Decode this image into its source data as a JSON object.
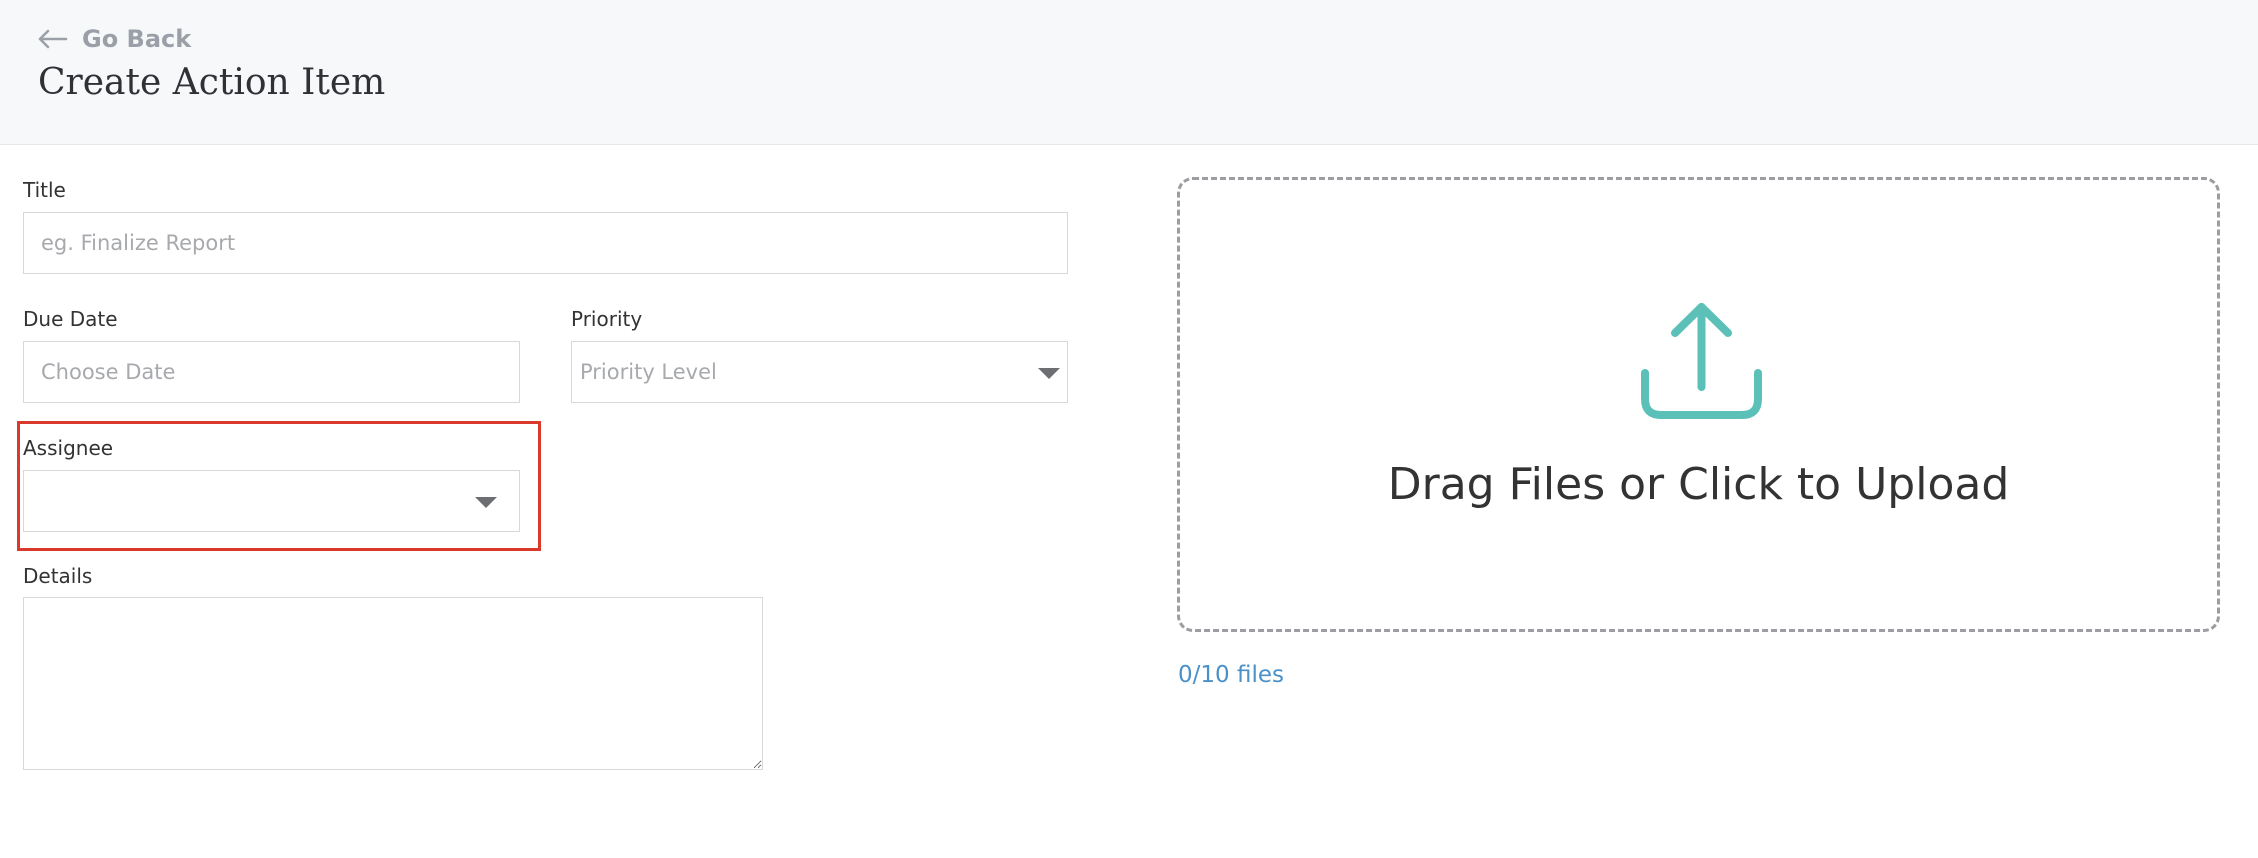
{
  "header": {
    "back_label": "Go Back",
    "title": "Create Action Item"
  },
  "form": {
    "title_label": "Title",
    "title_placeholder": "eg. Finalize Report",
    "title_value": "",
    "due_date_label": "Due Date",
    "due_date_placeholder": "Choose Date",
    "due_date_value": "",
    "priority_label": "Priority",
    "priority_value": "Priority Level",
    "assignee_label": "Assignee",
    "assignee_value": "",
    "details_label": "Details",
    "details_value": ""
  },
  "upload": {
    "prompt": "Drag Files or Click to Upload",
    "file_count": "0/10 files",
    "icon": "upload-icon"
  },
  "colors": {
    "accent_teal": "#5bc1b8",
    "link_blue": "#4a90c9",
    "highlight_red": "#d93a2b",
    "header_bg": "#f7f8fa"
  }
}
